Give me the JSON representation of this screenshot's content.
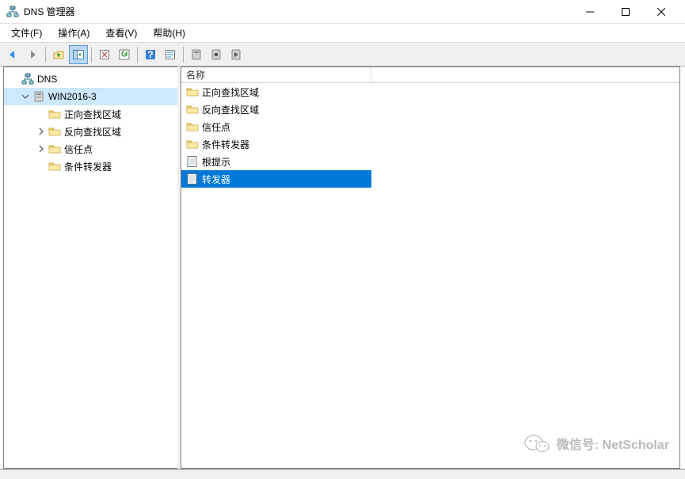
{
  "titlebar": {
    "title": "DNS 管理器"
  },
  "menu": {
    "file": "文件(F)",
    "action": "操作(A)",
    "view": "查看(V)",
    "help": "帮助(H)"
  },
  "tree": {
    "root_label": "DNS",
    "server_label": "WIN2016-3",
    "children": [
      {
        "label": "正向查找区域",
        "expandable": false
      },
      {
        "label": "反向查找区域",
        "expandable": true
      },
      {
        "label": "信任点",
        "expandable": true
      },
      {
        "label": "条件转发器",
        "expandable": false
      }
    ]
  },
  "list": {
    "column_header": "名称",
    "items": [
      {
        "label": "正向查找区域",
        "icon": "folder",
        "selected": false
      },
      {
        "label": "反向查找区域",
        "icon": "folder",
        "selected": false
      },
      {
        "label": "信任点",
        "icon": "folder",
        "selected": false
      },
      {
        "label": "条件转发器",
        "icon": "folder",
        "selected": false
      },
      {
        "label": "根提示",
        "icon": "sheet",
        "selected": false
      },
      {
        "label": "转发器",
        "icon": "sheet",
        "selected": true
      }
    ]
  },
  "watermark": {
    "text": "微信号: NetScholar"
  }
}
